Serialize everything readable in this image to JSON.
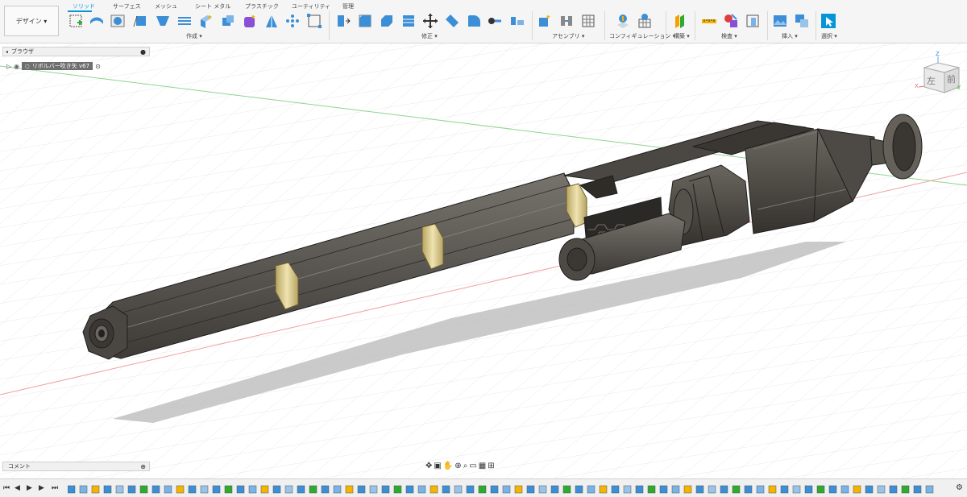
{
  "toolbar": {
    "design_label": "デザイン ▾",
    "tabs": [
      "ソリッド",
      "サーフェス",
      "メッシュ",
      "シート メタル",
      "プラスチック",
      "ユーティリティ",
      "管理"
    ],
    "groups": [
      "作成 ▾",
      "修正 ▾",
      "アセンブリ ▾",
      "コンフィギュレーション ▾",
      "構築 ▾",
      "検査 ▾",
      "挿入 ▾",
      "選択 ▾"
    ]
  },
  "browser": {
    "title": "ブラウザ",
    "root_item": "リボルバー吹き矢 v67"
  },
  "comments": {
    "title": "コメント"
  },
  "viewcube": {
    "left": "左",
    "front": "前",
    "axis_x": "X",
    "axis_y": "Y",
    "axis_z": "Z"
  },
  "colors": {
    "accent": "#0696d7",
    "model_body": "#5a5752",
    "model_dark": "#3d3a36",
    "band": "#d9c98a",
    "shadow": "#aaaaaa"
  }
}
